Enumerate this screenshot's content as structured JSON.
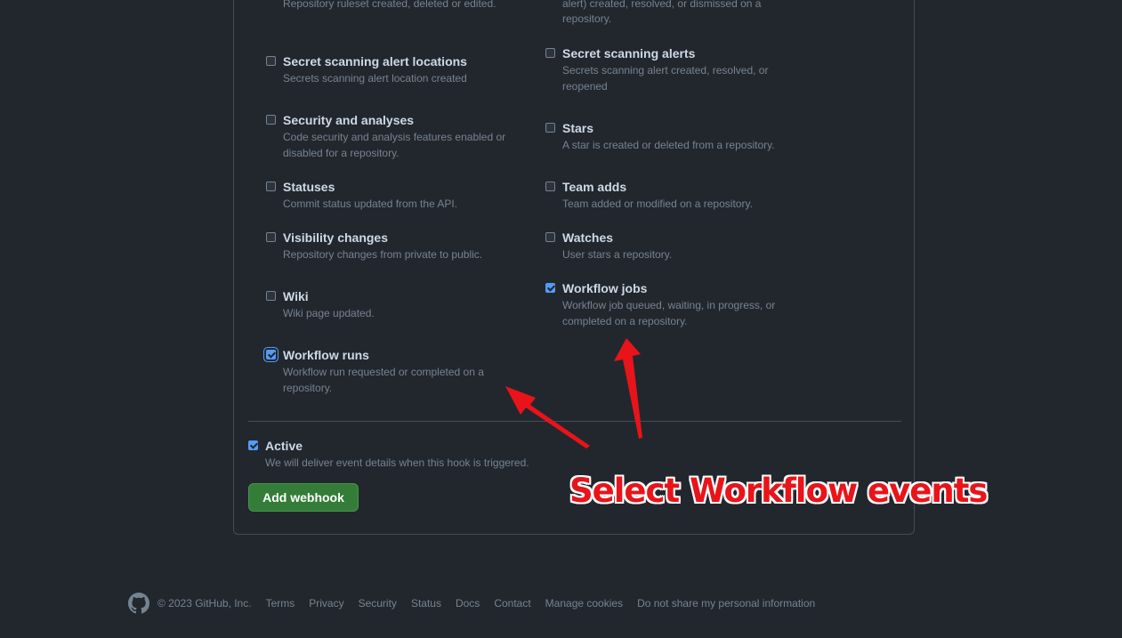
{
  "top_cut": {
    "left": "Repository ruleset created, deleted or edited.",
    "right_line1": "alert) created, resolved, or dismissed on a",
    "right_line2": "repository."
  },
  "events": [
    {
      "id": "secret-scanning-alert-locations",
      "title": "Secret scanning alert locations",
      "desc": "Secrets scanning alert location created",
      "checked": false
    },
    {
      "id": "secret-scanning-alerts",
      "title": "Secret scanning alerts",
      "desc": "Secrets scanning alert created, resolved, or reopened",
      "checked": false
    },
    {
      "id": "security-and-analyses",
      "title": "Security and analyses",
      "desc": "Code security and analysis features enabled or disabled for a repository.",
      "checked": false
    },
    {
      "id": "stars",
      "title": "Stars",
      "desc": "A star is created or deleted from a repository.",
      "checked": false
    },
    {
      "id": "statuses",
      "title": "Statuses",
      "desc": "Commit status updated from the API.",
      "checked": false
    },
    {
      "id": "team-adds",
      "title": "Team adds",
      "desc": "Team added or modified on a repository.",
      "checked": false
    },
    {
      "id": "visibility-changes",
      "title": "Visibility changes",
      "desc": "Repository changes from private to public.",
      "checked": false
    },
    {
      "id": "watches",
      "title": "Watches",
      "desc": "User stars a repository.",
      "checked": false
    },
    {
      "id": "wiki",
      "title": "Wiki",
      "desc": "Wiki page updated.",
      "checked": false
    },
    {
      "id": "workflow-jobs",
      "title": "Workflow jobs",
      "desc": "Workflow job queued, waiting, in progress, or completed on a repository.",
      "checked": true
    },
    {
      "id": "workflow-runs",
      "title": "Workflow runs",
      "desc": "Workflow run requested or completed on a repository.",
      "checked": true
    }
  ],
  "active": {
    "label": "Active",
    "desc": "We will deliver event details when this hook is triggered.",
    "checked": true
  },
  "add_webhook_label": "Add webhook",
  "annotation_text": "Select Workflow events",
  "footer": {
    "copyright": "© 2023 GitHub, Inc.",
    "links": [
      "Terms",
      "Privacy",
      "Security",
      "Status",
      "Docs",
      "Contact",
      "Manage cookies",
      "Do not share my personal information"
    ]
  },
  "colors": {
    "background": "#22272e",
    "accent_blue": "#539bf5",
    "button_green": "#347d39",
    "annotation_red": "#e8141a"
  }
}
